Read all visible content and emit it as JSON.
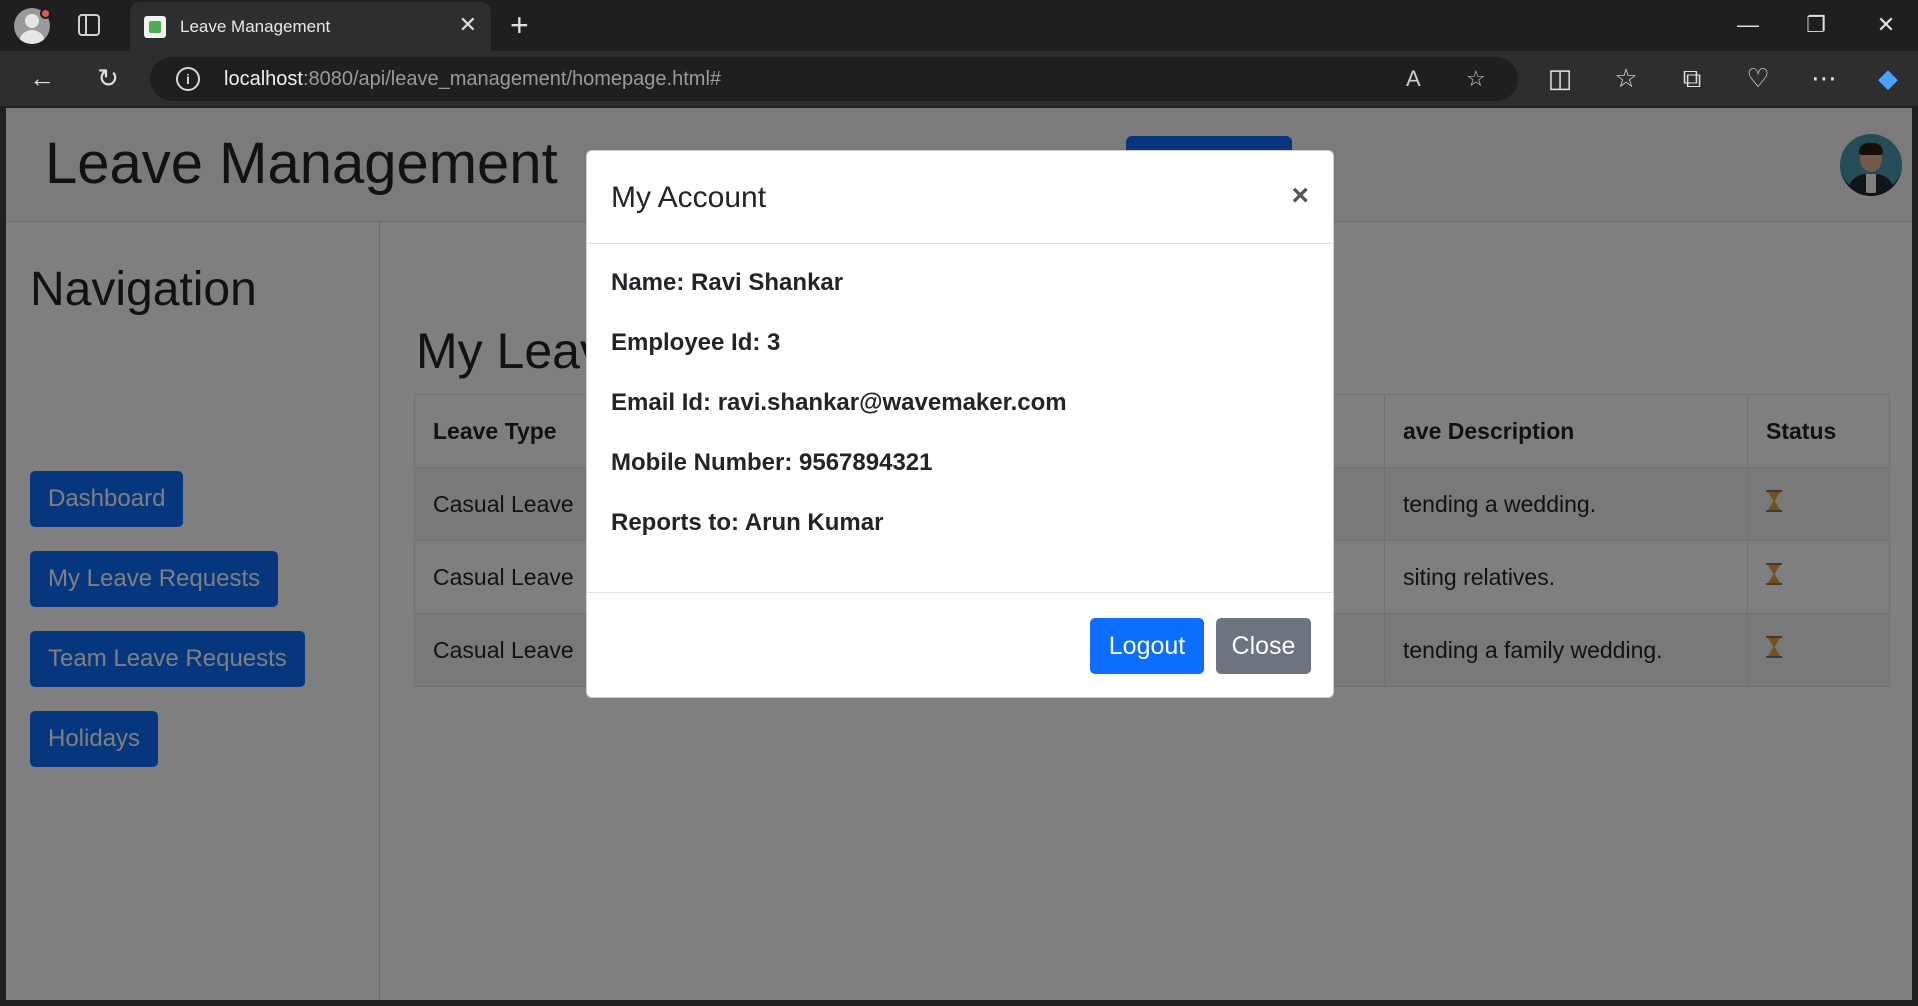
{
  "browser": {
    "tab_title": "Leave Management",
    "url_host": "localhost",
    "url_rest": ":8080/api/leave_management/homepage.html#"
  },
  "app": {
    "title": "Leave Management"
  },
  "navigation": {
    "title": "Navigation",
    "items": [
      {
        "label": "Dashboard"
      },
      {
        "label": "My Leave Requests"
      },
      {
        "label": "Team Leave Requests"
      },
      {
        "label": "Holidays"
      }
    ]
  },
  "content": {
    "title": "My Leav",
    "columns": [
      "Leave Type",
      "ave Description",
      "Status"
    ],
    "rows": [
      {
        "leave_type": "Casual Leave",
        "description": "tending a wedding.",
        "status": "hourglass-icon"
      },
      {
        "leave_type": "Casual Leave",
        "description": "siting relatives.",
        "status": "hourglass-icon"
      },
      {
        "leave_type": "Casual Leave",
        "description": "tending a family wedding.",
        "status": "hourglass-icon"
      }
    ]
  },
  "modal": {
    "title": "My Account",
    "close_symbol": "×",
    "details": [
      "Name: Ravi Shankar",
      "Employee Id: 3",
      "Email Id: ravi.shankar@wavemaker.com",
      "Mobile Number: 9567894321",
      "Reports to: Arun Kumar"
    ],
    "logout_label": "Logout",
    "close_label": "Close"
  },
  "colors": {
    "primary": "#0d6efd",
    "secondary": "#6c757d",
    "backdrop": "rgba(0,0,0,0.5)"
  }
}
